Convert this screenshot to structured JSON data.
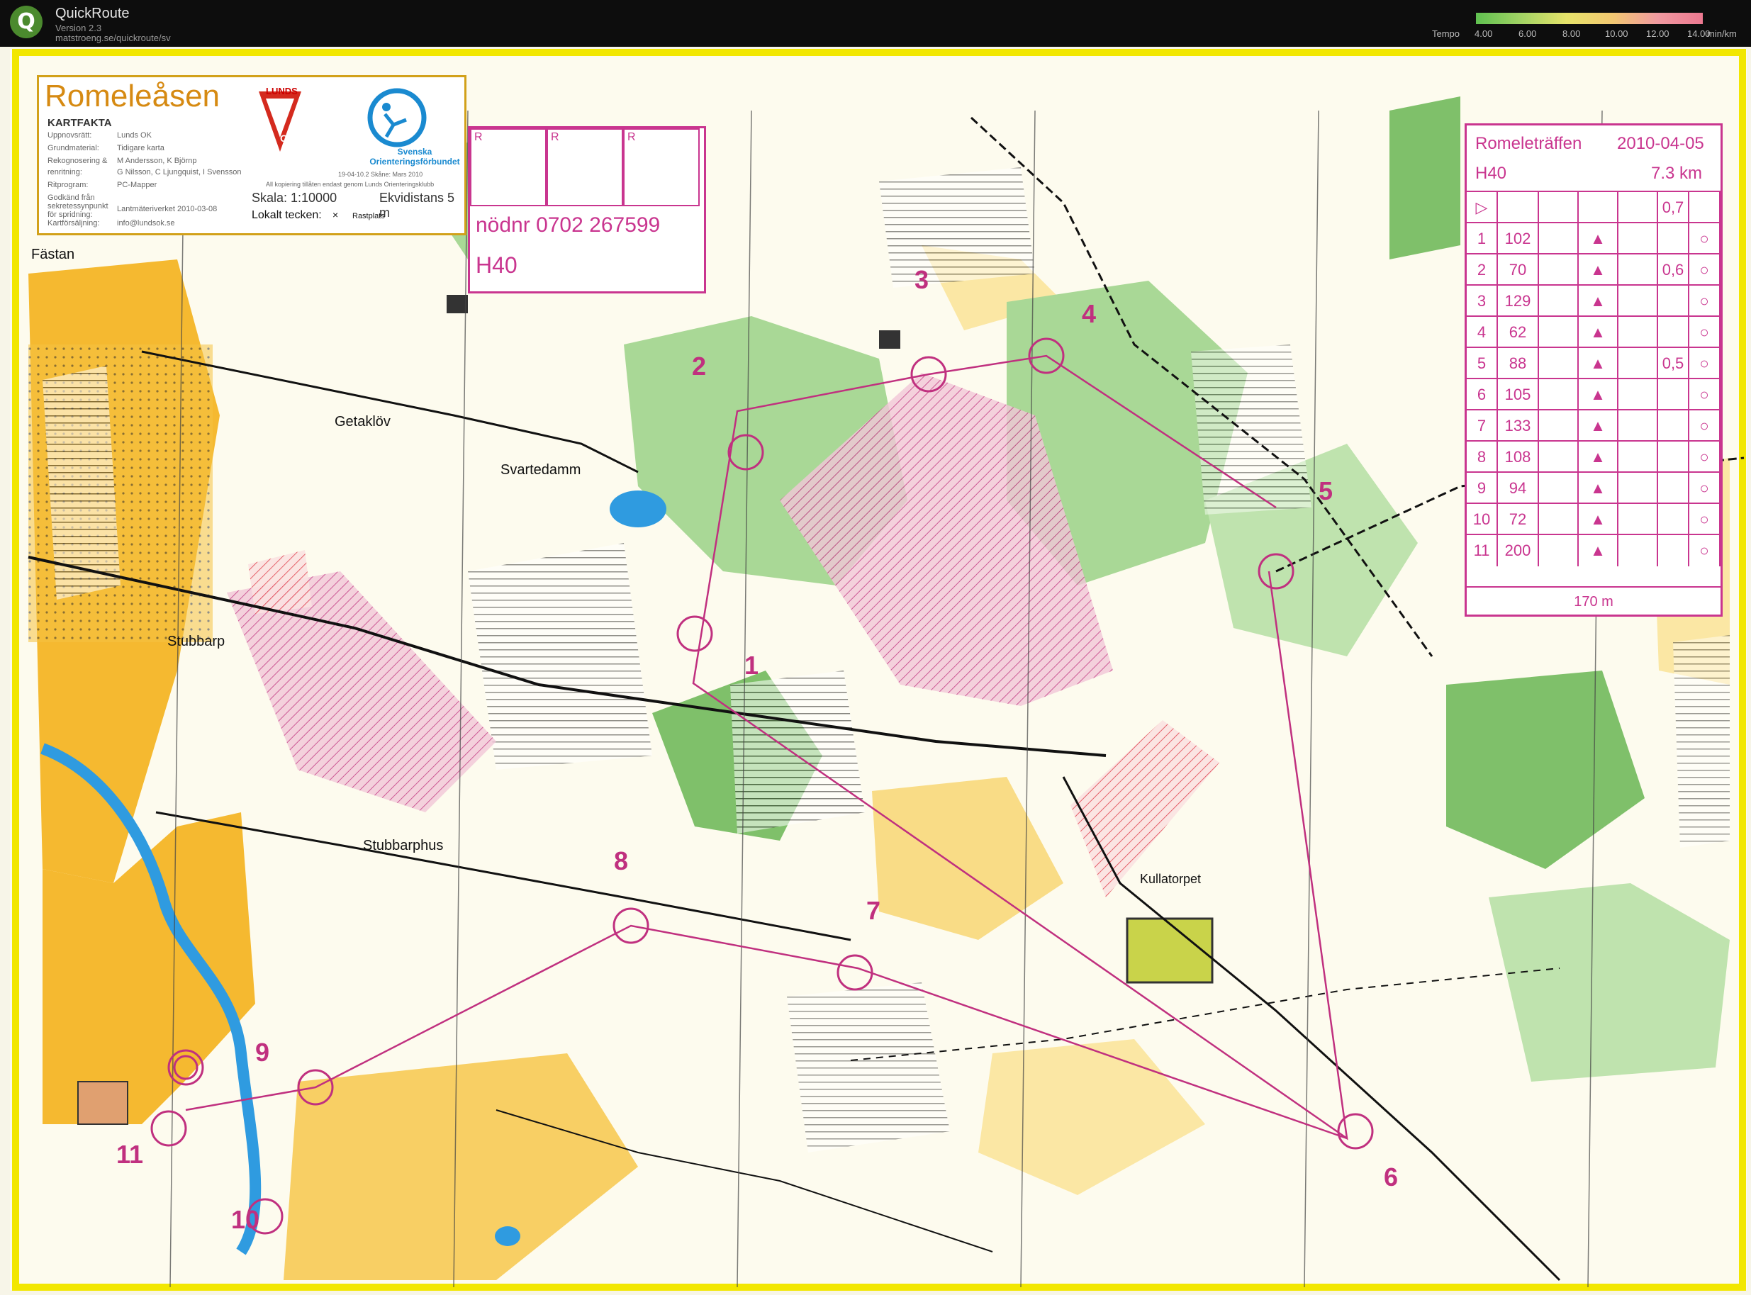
{
  "app": {
    "name": "QuickRoute",
    "version": "Version 2.3",
    "url": "matstroeng.se/quickroute/sv",
    "logo_letter": "Q"
  },
  "tempo_legend": {
    "label": "Tempo",
    "ticks": [
      "4.00",
      "6.00",
      "8.00",
      "10.00",
      "12.00",
      "14.00"
    ],
    "unit": "min/km"
  },
  "map": {
    "name": "Romeleåsen",
    "kartfakta": {
      "heading": "KARTFAKTA",
      "rows": [
        {
          "label": "Uppnovsrätt:",
          "value": "Lunds OK"
        },
        {
          "label": "Grundmaterial:",
          "value": "Tidigare karta"
        },
        {
          "label": "Rekognosering &",
          "value": "M Andersson, K Björnp"
        },
        {
          "label": "renritning:",
          "value": "G Nilsson, C Ljungquist, I Svensson"
        },
        {
          "label": "Ritprogram:",
          "value": "PC-Mapper"
        },
        {
          "label": "Godkänd från sekretessynpunkt för spridning:",
          "value": "Lantmäteriverket 2010-03-08"
        },
        {
          "label": "Kartförsäljning:",
          "value": "info@lundsok.se"
        }
      ]
    },
    "club_logo": "LUNDS",
    "club_logo_ok": "OK",
    "sof_text": "Svenska Orienteringsförbundet",
    "sof_date": "19-04-10.2 Skåne: Mars 2010",
    "copyright": "All kopiering tillåten endast genom Lunds Orienteringsklubb",
    "scale": "Skala: 1:10000",
    "equidistance": "Ekvidistans 5 m",
    "local_symbol": "Lokalt tecken:",
    "local_symbol_mark": "×",
    "rastplats": "Rastplats",
    "place_names": [
      "Fästan",
      "Getaklöv",
      "Svartedamm",
      "Stubbarp",
      "Stubbarphus",
      "Kullatorpet"
    ]
  },
  "registration": {
    "boxes": [
      "R",
      "R",
      "R"
    ],
    "emergency": "nödnr 0702 267599",
    "course": "H40"
  },
  "controls": {
    "numbers": [
      "1",
      "2",
      "3",
      "4",
      "5",
      "6",
      "7",
      "8",
      "9",
      "10",
      "11"
    ]
  },
  "description_sheet": {
    "event": "Romeleträffen",
    "date": "2010-04-05",
    "class": "H40",
    "length": "7.3 km",
    "start_symbol": "▷",
    "start_extra": "0,7",
    "rows": [
      {
        "num": "1",
        "code": "102",
        "extra": ""
      },
      {
        "num": "2",
        "code": "70",
        "extra": "0,6"
      },
      {
        "num": "3",
        "code": "129",
        "extra": ""
      },
      {
        "num": "4",
        "code": "62",
        "extra": ""
      },
      {
        "num": "5",
        "code": "88",
        "extra": "0,5"
      },
      {
        "num": "6",
        "code": "105",
        "extra": ""
      },
      {
        "num": "7",
        "code": "133",
        "extra": ""
      },
      {
        "num": "8",
        "code": "108",
        "extra": ""
      },
      {
        "num": "9",
        "code": "94",
        "extra": ""
      },
      {
        "num": "10",
        "code": "72",
        "extra": ""
      },
      {
        "num": "11",
        "code": "200",
        "extra": ""
      }
    ],
    "finish": "170 m"
  },
  "colors": {
    "forest_green": "#7fc06a",
    "open_yellow": "#f5b930",
    "course_magenta": "#c0307f",
    "water_blue": "#2f9be0"
  }
}
